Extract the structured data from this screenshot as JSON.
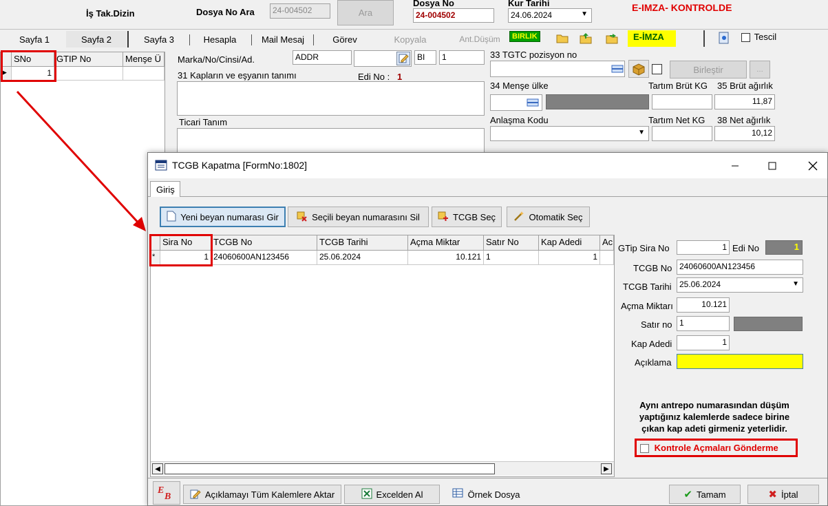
{
  "header": {
    "is_tak_dizin": "İş Tak.Dizin",
    "dosya_no_ara_label": "Dosya No Ara",
    "dosya_no_ara_value": "24-004502",
    "ara_button": "Ara",
    "dosya_no_label": "Dosya No",
    "dosya_no_value": "24-004502",
    "kur_tarihi_label": "Kur Tarihi",
    "kur_tarihi_value": "24.06.2024",
    "eimza_status": "E-IMZA- KONTROLDE"
  },
  "tabs": [
    "Sayfa 1",
    "Sayfa 2",
    "Sayfa 3",
    "Hesapla",
    "Mail Mesaj",
    "Görev",
    "Kopyala",
    "Ant.Düşüm"
  ],
  "toolbar": {
    "birlik": "BIRLIK",
    "eimza_button": "E-İMZA",
    "tescil_label": "Tescil"
  },
  "left_grid": {
    "headers": [
      "SNo",
      "GTIP No",
      "Menşe Ü"
    ],
    "rows": [
      {
        "sno": "1",
        "gtip": "",
        "mense": ""
      }
    ]
  },
  "form": {
    "marka_label": "Marka/No/Cinsi/Ad.",
    "marka_value": "ADDR",
    "bi_value": "BI",
    "one_value": "1",
    "kaplar_label": "31 Kapların ve eşyanın tanımı",
    "edi_no_label": "Edi No :",
    "edi_no_value": "1",
    "ticari_tanim_label": "Ticari Tanım",
    "tgtc_label": "33 TGTC pozisyon no",
    "birlestir_button": "Birleştir",
    "mense_label": "34 Menşe ülke",
    "tartim_brut_label": "Tartım Brüt KG",
    "brut_label": "35 Brüt ağırlık",
    "brut_value": "11,87",
    "anlasma_label": "Anlaşma Kodu",
    "tartim_net_label": "Tartım Net KG",
    "net_label": "38 Net ağırlık",
    "net_value": "10,12"
  },
  "dialog": {
    "title": "TCGB Kapatma [FormNo:1802]",
    "tab": "Giriş",
    "buttons": {
      "yeni": "Yeni beyan numarası Gir",
      "secili_sil": "Seçili beyan numarasını Sil",
      "tcgb_sec": "TCGB Seç",
      "otomatik": "Otomatik Seç",
      "aciklama_aktar": "Açıklamayı Tüm Kalemlere Aktar",
      "excel": "Excelden Al",
      "ornek": "Örnek Dosya",
      "tamam": "Tamam",
      "iptal": "İptal"
    },
    "grid_headers": [
      "Sira No",
      "TCGB No",
      "TCGB Tarihi",
      "Açma Miktar",
      "Satır No",
      "Kap Adedi",
      "Ac"
    ],
    "grid_rows": [
      {
        "marker": "*",
        "sira_no": "1",
        "tcgb_no": "24060600AN123456",
        "tarih": "25.06.2024",
        "acma": "10.121",
        "satir": "1",
        "kap": "1"
      }
    ],
    "right": {
      "gtip_sira_label": "GTip Sira No",
      "gtip_sira_value": "1",
      "edi_no_label": "Edi No",
      "edi_no_value": "1",
      "tcgb_no_label": "TCGB No",
      "tcgb_no_value": "24060600AN123456",
      "tcgb_tarihi_label": "TCGB Tarihi",
      "tcgb_tarihi_value": "25.06.2024",
      "acma_label": "Açma Miktarı",
      "acma_value": "10.121",
      "satir_label": "Satır no",
      "satir_value": "1",
      "kap_label": "Kap Adedi",
      "kap_value": "1",
      "aciklama_label": "Açıklama",
      "aciklama_value": "",
      "info_note": "Aynı antrepo numarasından düşüm yaptığınız kalemlerde sadece birine çıkan kap adeti girmeniz yeterlidir.",
      "kontrole_label": "Kontrole Açmaları Gönderme"
    }
  },
  "colors": {
    "highlight_red": "#e00000",
    "aciklama_yellow": "#ffff00",
    "eimza_yellow": "#ffff00",
    "birlik_green": "#00a000"
  }
}
